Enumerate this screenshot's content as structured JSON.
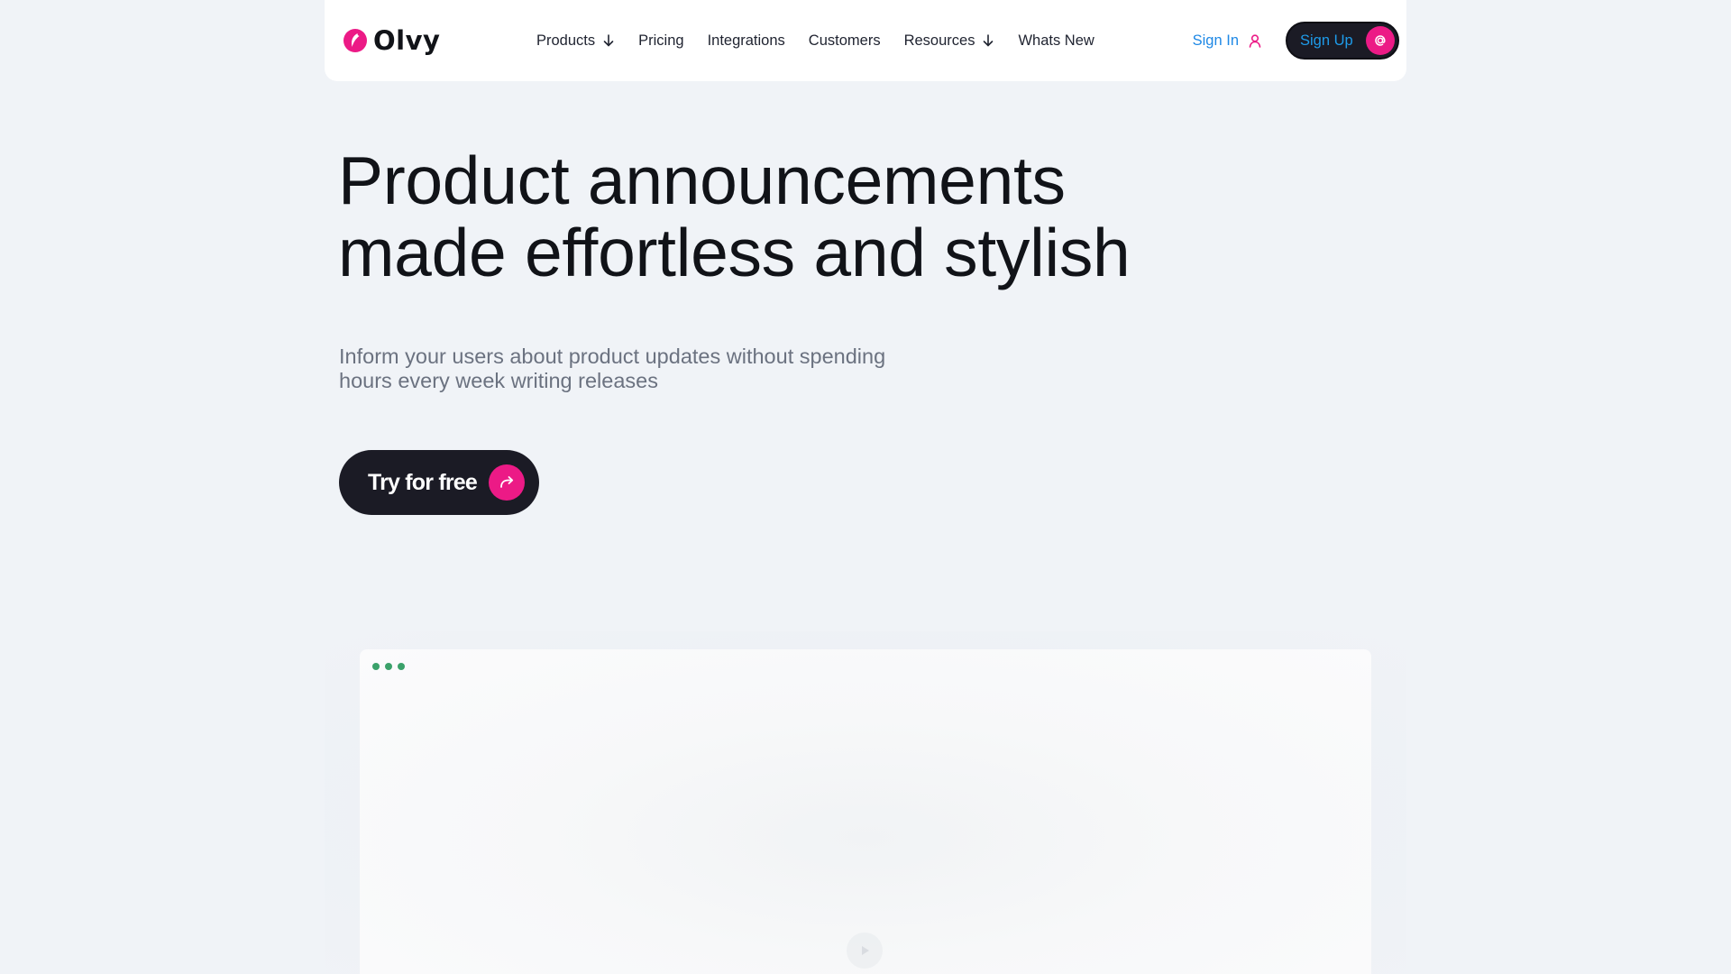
{
  "brand": {
    "name": "Olvy",
    "accent_color": "#ec1a86",
    "dark_color": "#1b1b25",
    "link_color": "#1e88e5"
  },
  "nav": {
    "items": [
      {
        "label": "Products",
        "has_dropdown": true
      },
      {
        "label": "Pricing",
        "has_dropdown": false
      },
      {
        "label": "Integrations",
        "has_dropdown": false
      },
      {
        "label": "Customers",
        "has_dropdown": false
      },
      {
        "label": "Resources",
        "has_dropdown": true
      },
      {
        "label": "Whats New",
        "has_dropdown": false
      }
    ],
    "sign_in_label": "Sign In",
    "sign_in_icon": "user-icon",
    "sign_up_label": "Sign Up",
    "sign_up_icon": "at-sign-icon"
  },
  "hero": {
    "title_line1": "Product announcements",
    "title_line2": "made effortless and stylish",
    "subtitle_line1": "Inform your users about product updates without spending",
    "subtitle_line2": "hours every week writing releases",
    "cta_label": "Try for free",
    "cta_icon": "curved-arrow-icon"
  },
  "preview": {
    "window_dots_color": "#3aa16a",
    "play_icon": "play-icon"
  }
}
